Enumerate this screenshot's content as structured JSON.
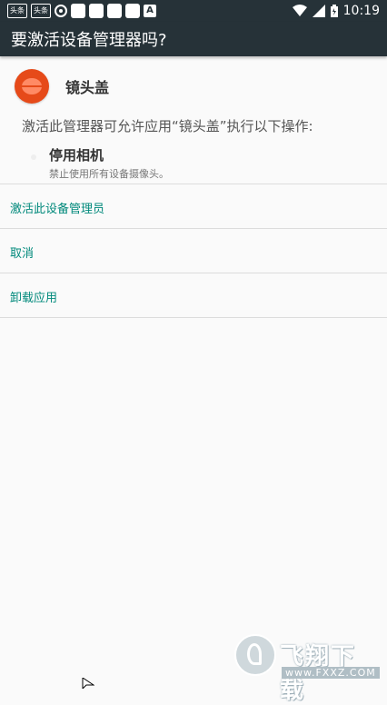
{
  "status_bar": {
    "notif1": "头条",
    "notif2": "头条",
    "notif_a": "A",
    "time": "10:19"
  },
  "dialog": {
    "title": "要激活设备管理器吗?",
    "app_name": "镜头盖",
    "description": "激活此管理器可允许应用“镜头盖”执行以下操作:",
    "policy_title": "停用相机",
    "policy_desc": "禁止使用所有设备摄像头。"
  },
  "actions": {
    "activate": "激活此设备管理员",
    "cancel": "取消",
    "uninstall": "卸载应用"
  },
  "watermark": {
    "text": "飞翔下载",
    "url": "www.FXXZ.COM"
  },
  "colors": {
    "status_bar": "#263238",
    "accent": "#00897b",
    "app_icon": "#e64a19"
  }
}
